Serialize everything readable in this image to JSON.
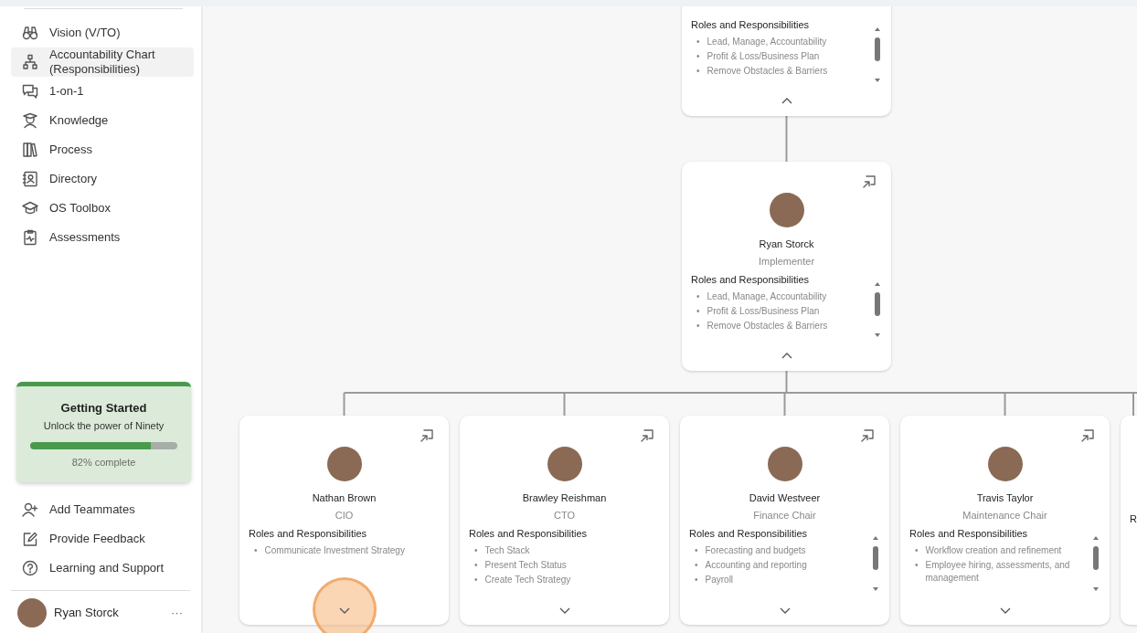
{
  "sidebar": {
    "items": [
      {
        "label": "Vision (V/TO)",
        "selected": false
      },
      {
        "label": "Accountability Chart (Responsibilities)",
        "selected": true
      },
      {
        "label": "1-on-1",
        "selected": false
      },
      {
        "label": "Knowledge",
        "selected": false
      },
      {
        "label": "Process",
        "selected": false
      },
      {
        "label": "Directory",
        "selected": false
      },
      {
        "label": "OS Toolbox",
        "selected": false
      },
      {
        "label": "Assessments",
        "selected": false
      }
    ],
    "getting_started": {
      "title": "Getting Started",
      "subtitle": "Unlock the power of Ninety",
      "level": 0.82,
      "progress_text": "82% complete"
    },
    "footer_items": [
      {
        "label": "Add Teammates"
      },
      {
        "label": "Provide Feedback"
      },
      {
        "label": "Learning and Support"
      }
    ],
    "user": {
      "name": "Ryan Storck",
      "menu": "···"
    }
  },
  "chart": {
    "rows": [
      {
        "nodes": [
          {
            "roles_heading": "Roles and Responsibilities",
            "bullet": "•",
            "responsibilities": [
              "Lead, Manage, Accountability",
              "Profit & Loss/Business Plan",
              "Remove Obstacles & Barriers"
            ],
            "scrollable": true,
            "expanded": true,
            "highlighted": false
          }
        ]
      },
      {
        "nodes": [
          {
            "name": "Ryan Storck",
            "role": "Implementer",
            "roles_heading": "Roles and Responsibilities",
            "bullet": "•",
            "responsibilities": [
              "Lead, Manage, Accountability",
              "Profit & Loss/Business Plan",
              "Remove Obstacles & Barriers"
            ],
            "scrollable": true,
            "expanded": true,
            "highlighted": false
          }
        ]
      },
      {
        "nodes": [
          {
            "name": "Nathan Brown",
            "role": "CIO",
            "roles_heading": "Roles and Responsibilities",
            "bullet": "•",
            "responsibilities": [
              "Communicate Investment Strategy"
            ],
            "scrollable": false,
            "expanded": false,
            "highlighted": true
          },
          {
            "name": "Brawley Reishman",
            "role": "CTO",
            "roles_heading": "Roles and Responsibilities",
            "bullet": "•",
            "responsibilities": [
              "Tech Stack",
              "Present Tech Status",
              "Create Tech Strategy"
            ],
            "scrollable": false,
            "expanded": false,
            "highlighted": false
          },
          {
            "name": "David Westveer",
            "role": "Finance Chair",
            "roles_heading": "Roles and Responsibilities",
            "bullet": "•",
            "responsibilities": [
              "Forecasting and budgets",
              "Accounting and reporting",
              "Payroll"
            ],
            "scrollable": true,
            "expanded": false,
            "highlighted": false
          },
          {
            "name": "Travis Taylor",
            "role": "Maintenance Chair",
            "roles_heading": "Roles and Responsibilities",
            "bullet": "•",
            "responsibilities": [
              "Workflow creation and refinement",
              "Employee hiring, assessments, and management"
            ],
            "scrollable": true,
            "expanded": false,
            "highlighted": false
          },
          {
            "roles_heading": "R"
          }
        ]
      }
    ]
  }
}
